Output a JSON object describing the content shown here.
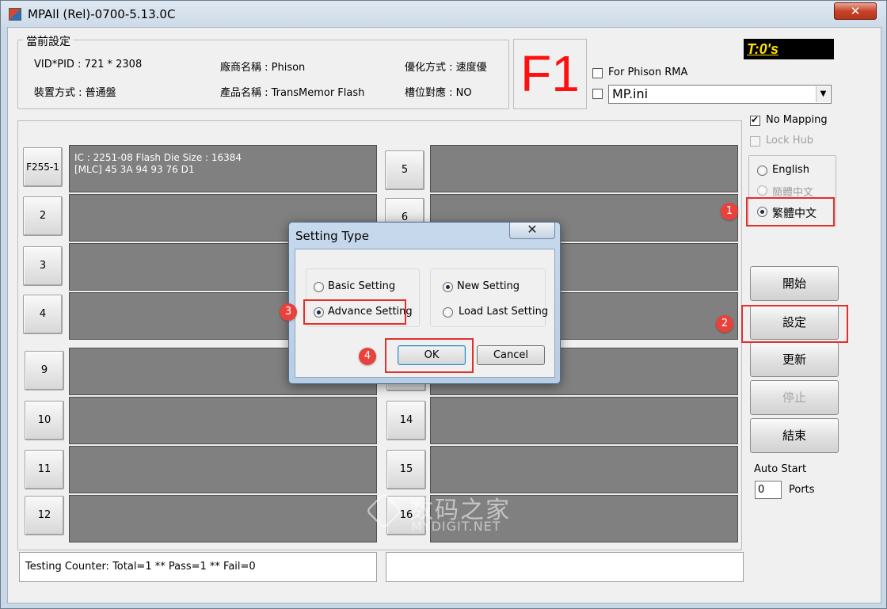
{
  "window": {
    "title": "MPAll (Rel)-0700-5.13.0C",
    "close_label": "✕"
  },
  "current_settings": {
    "legend": "當前設定",
    "vidpid": "VID*PID : 721 * 2308",
    "vendor": "廠商名稱 : Phison",
    "optimize": "優化方式 : 速度優",
    "mount": "裝置方式 : 普通盤",
    "product": "產品名稱 : TransMemor Flash",
    "slot_map": "槽位對應 : NO"
  },
  "f1_label": "F1",
  "timer": "T:0's",
  "phison_rma": {
    "label": "For Phison RMA",
    "checked": false
  },
  "ini": {
    "value": "MP.ini"
  },
  "no_mapping": {
    "label": "No Mapping",
    "checked": true
  },
  "lock_hub": {
    "label": "Lock Hub",
    "checked": false
  },
  "language": {
    "options": [
      {
        "label": "English",
        "checked": false,
        "disabled": false
      },
      {
        "label": "簡體中文",
        "checked": false,
        "disabled": true
      },
      {
        "label": "繁體中文",
        "checked": true,
        "disabled": false
      }
    ]
  },
  "ports": {
    "left": [
      {
        "label": "F255-1",
        "info1": "IC : 2251-08  Flash Die Size : 16384",
        "info2": "[MLC] 45 3A 94 93 76 D1"
      },
      {
        "label": "2",
        "info1": "",
        "info2": ""
      },
      {
        "label": "3",
        "info1": "",
        "info2": ""
      },
      {
        "label": "4",
        "info1": "",
        "info2": ""
      },
      {
        "label": "9",
        "info1": "",
        "info2": ""
      },
      {
        "label": "10",
        "info1": "",
        "info2": ""
      },
      {
        "label": "11",
        "info1": "",
        "info2": ""
      },
      {
        "label": "12",
        "info1": "",
        "info2": ""
      }
    ],
    "right": [
      {
        "label": "5"
      },
      {
        "label": "6"
      },
      {
        "label": ""
      },
      {
        "label": ""
      },
      {
        "label": ""
      },
      {
        "label": "14"
      },
      {
        "label": "15"
      },
      {
        "label": "16"
      }
    ]
  },
  "buttons": {
    "start": "開始",
    "settings": "設定",
    "update": "更新",
    "stop": "停止",
    "exit": "結束"
  },
  "auto_start": {
    "label": "Auto Start",
    "value": "0",
    "ports_label": "Ports"
  },
  "status": {
    "counter": "Testing Counter: Total=1 ** Pass=1 ** Fail=0",
    "right": ""
  },
  "dialog": {
    "title": "Setting Type",
    "close_label": "✕",
    "basic": {
      "label": "Basic Setting",
      "checked": false
    },
    "advance": {
      "label": "Advance Setting",
      "checked": true
    },
    "new_setting": {
      "label": "New Setting",
      "checked": true
    },
    "load_last": {
      "label": "Load Last Setting",
      "checked": false
    },
    "ok": "OK",
    "cancel": "Cancel"
  },
  "annotations": [
    "1",
    "2",
    "3",
    "4"
  ],
  "watermark": {
    "cn": "数码之家",
    "en": "MYDIGIT.NET"
  },
  "colors": {
    "highlight": "#e0302c",
    "timer_text": "#ffe000",
    "f1": "#ff1010"
  }
}
